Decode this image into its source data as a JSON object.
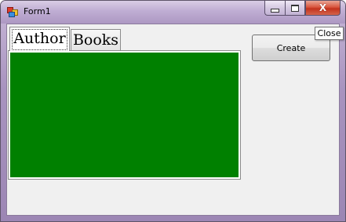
{
  "window": {
    "title": "Form1",
    "icon": "app-form-icon"
  },
  "caption": {
    "minimize_icon": "minimize-icon",
    "maximize_icon": "maximize-icon",
    "close_glyph": "X",
    "close_tooltip": "Close"
  },
  "tabs": [
    {
      "label": "Author",
      "selected": true
    },
    {
      "label": "Books",
      "selected": false
    }
  ],
  "panel": {
    "background_color": "#008000"
  },
  "buttons": {
    "create_label": "Create"
  }
}
